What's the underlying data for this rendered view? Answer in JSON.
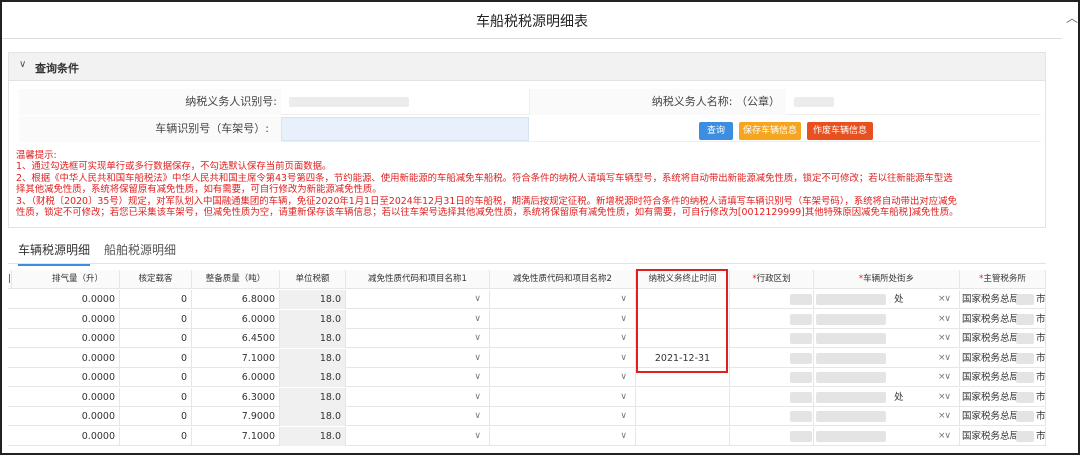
{
  "page": {
    "title": "车船税税源明细表",
    "scroll_up_icon": "chevron-up-icon"
  },
  "query": {
    "section_label": "查询条件",
    "taxpayer_id_label": "纳税义务人识别号:",
    "taxpayer_name_label": "纳税义务人名称: （公章）",
    "vehicle_id_label": "车辆识别号（车架号）:",
    "buttons": {
      "query": "查询",
      "save": "保存车辆信息",
      "void": "作废车辆信息"
    }
  },
  "tips": {
    "title": "温馨提示:",
    "lines": [
      "1、通过勾选框可实现单行或多行数据保存，不勾选默认保存当前页面数据。",
      "2、根据《中华人民共和国车船税法》中华人民共和国主席令第43号第四条，节约能源、使用新能源的车船减免车船税。符合条件的纳税人请填写车辆型号，系统将自动带出新能源减免性质，锁定不可修改；若以往新能源车型选",
      "择其他减免性质，系统将保留原有减免性质，如有需要，可自行修改为新能源减免性质。",
      "3、（财税〔2020〕35号）规定，对军队划入中国融通集团的车辆，免征2020年1月1日至2024年12月31日的车船税，期满后按规定征税。新增税源时符合条件的纳税人请填写车辆识别号（车架号码），系统将自动带出对应减免",
      "性质，锁定不可修改；若您已采集该车架号，但减免性质为空，请重新保存该车辆信息；若以往车架号选择其他减免性质，系统将保留原有减免性质，如有需要，可自行修改为[0012129999]其他特殊原因减免车船税]减免性质。"
    ]
  },
  "tabs": [
    {
      "label": "车辆税源明细",
      "active": true
    },
    {
      "label": "船舶税源明细",
      "active": false
    }
  ],
  "table": {
    "headers": {
      "displacement": "排气量（升）",
      "rated_load": "核定载客",
      "curb_weight": "整备质量（吨）",
      "unit_tax": "单位税额",
      "exemption1": "减免性质代码和项目名称1",
      "exemption2": "减免性质代码和项目名称2",
      "end_time": "纳税义务终止时间",
      "admin_region": "行政区划",
      "street": "车辆所处街乡",
      "tax_office": "主管税务所"
    },
    "required_mark": "*",
    "rows": [
      {
        "displacement": "0.0000",
        "rated_load": "0",
        "curb_weight": "6.8000",
        "unit_tax": "18.0",
        "end_time": "",
        "street_suffix": "处",
        "tax_office": "国家税务总局",
        "tax_office_suffix": "市"
      },
      {
        "displacement": "0.0000",
        "rated_load": "0",
        "curb_weight": "6.0000",
        "unit_tax": "18.0",
        "end_time": "",
        "street_suffix": "",
        "tax_office": "国家税务总局",
        "tax_office_suffix": "市"
      },
      {
        "displacement": "0.0000",
        "rated_load": "0",
        "curb_weight": "6.4500",
        "unit_tax": "18.0",
        "end_time": "",
        "street_suffix": "",
        "tax_office": "国家税务总局",
        "tax_office_suffix": "市"
      },
      {
        "displacement": "0.0000",
        "rated_load": "0",
        "curb_weight": "7.1000",
        "unit_tax": "18.0",
        "end_time": "2021-12-31",
        "street_suffix": "",
        "tax_office": "国家税务总局",
        "tax_office_suffix": "市"
      },
      {
        "displacement": "0.0000",
        "rated_load": "0",
        "curb_weight": "6.0000",
        "unit_tax": "18.0",
        "end_time": "",
        "street_suffix": "",
        "tax_office": "国家税务总局",
        "tax_office_suffix": "市"
      },
      {
        "displacement": "0.0000",
        "rated_load": "0",
        "curb_weight": "6.3000",
        "unit_tax": "18.0",
        "end_time": "",
        "street_suffix": "处",
        "tax_office": "国家税务总局",
        "tax_office_suffix": "市"
      },
      {
        "displacement": "0.0000",
        "rated_load": "0",
        "curb_weight": "7.9000",
        "unit_tax": "18.0",
        "end_time": "",
        "street_suffix": "",
        "tax_office": "国家税务总局",
        "tax_office_suffix": "市"
      },
      {
        "displacement": "0.0000",
        "rated_load": "0",
        "curb_weight": "7.1000",
        "unit_tax": "18.0",
        "end_time": "",
        "street_suffix": "",
        "tax_office": "国家税务总局",
        "tax_office_suffix": "市"
      }
    ]
  },
  "icons": {
    "collapse": "chevron-down-icon",
    "select_arrow": "chevron-down-icon",
    "clear": "close-icon"
  },
  "colors": {
    "accent_blue": "#3c8ee0",
    "warning_red": "#e02020",
    "button_orange": "#f6a51f",
    "button_red": "#e8511f"
  }
}
